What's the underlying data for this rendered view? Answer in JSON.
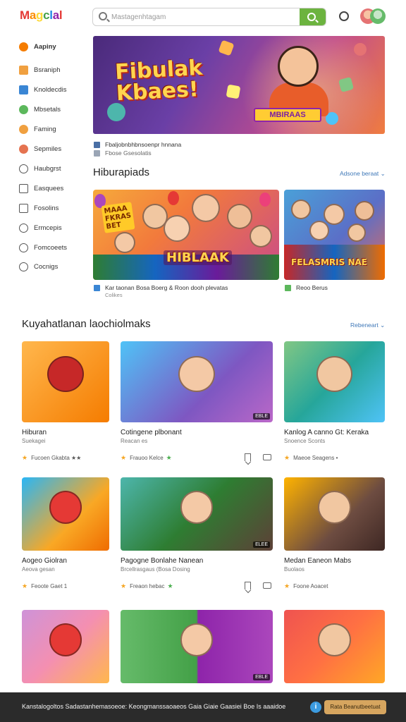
{
  "header": {
    "logo_letters": [
      "M",
      "a",
      "g",
      "c",
      "l",
      "a",
      "l"
    ],
    "search_placeholder": "Mastagenhtagam",
    "icons": [
      "search-icon",
      "notification-icon",
      "user-avatar"
    ]
  },
  "sidebar": {
    "items": [
      {
        "label": "Aapiny",
        "icon": "home-icon",
        "color": "#f57c00",
        "active": true
      },
      {
        "label": "Bsraniph",
        "icon": "calendar-icon",
        "color": "#f0a040"
      },
      {
        "label": "Knoldecdis",
        "icon": "grid-icon",
        "color": "#3a86d4"
      },
      {
        "label": "Mbsetals",
        "icon": "globe-icon",
        "color": "#5cb85c"
      },
      {
        "label": "Faming",
        "icon": "heart-icon",
        "color": "#f0a040"
      },
      {
        "label": "Sepmiles",
        "icon": "clock-icon",
        "color": "#e57350"
      },
      {
        "label": "Haubgrst",
        "icon": "leaf-icon",
        "color": "#555555"
      },
      {
        "label": "Easquees",
        "icon": "bag-icon",
        "color": "#555555"
      },
      {
        "label": "Fosolins",
        "icon": "folder-icon",
        "color": "#555555"
      },
      {
        "label": "Ermcepis",
        "icon": "gear-icon",
        "color": "#555555"
      },
      {
        "label": "Fomcoeets",
        "icon": "circle-icon",
        "color": "#555555"
      },
      {
        "label": "Cocnigs",
        "icon": "chat-icon",
        "color": "#555555"
      }
    ]
  },
  "hero": {
    "title": "Fibulak\nKbaes!",
    "chip": "MBIRAAS",
    "caption": "Fbaljobnbhbnsoenpr hnnana",
    "caption_sub": "Fbose Gsesolatis"
  },
  "section1": {
    "title": "Hiburapiads",
    "link": "Adsone beraat",
    "cards": [
      {
        "badge": "HIBLAAK",
        "corner": "MAAA\nFKRAS\nBET",
        "caption": "Kar taonan Bosa Boerg & Roon dooh plevatas",
        "caption_sub": "Colikes"
      },
      {
        "badge": "FELASMRIS NAE",
        "caption": "Reoo Berus"
      }
    ]
  },
  "section2": {
    "title": "Kuyahatlanan laochiolmaks",
    "link": "Rebeneart",
    "rows": [
      [
        {
          "title": "Hiburan",
          "sub": "Suekagei",
          "meta": "Fucoen Gkabta ★★",
          "tag": ""
        },
        {
          "title": "Cotingene plbonant",
          "sub": "Reacan es",
          "meta": "Frauoo Kelce",
          "tag": "EBLE"
        },
        {
          "title": "Kanlog A canno Gt: Keraka",
          "sub": "Snoence Sconts",
          "meta": "Maeoe Seagens •",
          "tag": ""
        }
      ],
      [
        {
          "title": "Aogeo Giolran",
          "sub": "Aeova gesan",
          "meta": "Feoote Gaet 1",
          "tag": ""
        },
        {
          "title": "Pagogne Bonlahe Nanean",
          "sub": "Brcellrasgaus (Bosa Dosing",
          "meta": "Freaon hebac",
          "tag": "ELEE"
        },
        {
          "title": "Medan Eaneon Mabs",
          "sub": "Buolaos",
          "meta": "Foone Aoacet",
          "tag": ""
        }
      ],
      [
        {
          "title": "",
          "sub": "",
          "meta": "",
          "tag": ""
        },
        {
          "title": "",
          "sub": "",
          "meta": "",
          "tag": "EBLE"
        },
        {
          "title": "",
          "sub": "",
          "meta": "",
          "tag": ""
        }
      ]
    ]
  },
  "cookie": {
    "text": "Kanstalogoltos Sadastanhemasoeoe: Keongmanssaoaeos Gaia Giaie Gaasiei Boe Is aaaidoe",
    "button": "Rata Beanutbeetuat"
  },
  "colors": {
    "accent": "#6cb33f",
    "link": "#3f78b8",
    "cookie_bg": "#2b2b2b",
    "cookie_button": "#d6a55f"
  }
}
